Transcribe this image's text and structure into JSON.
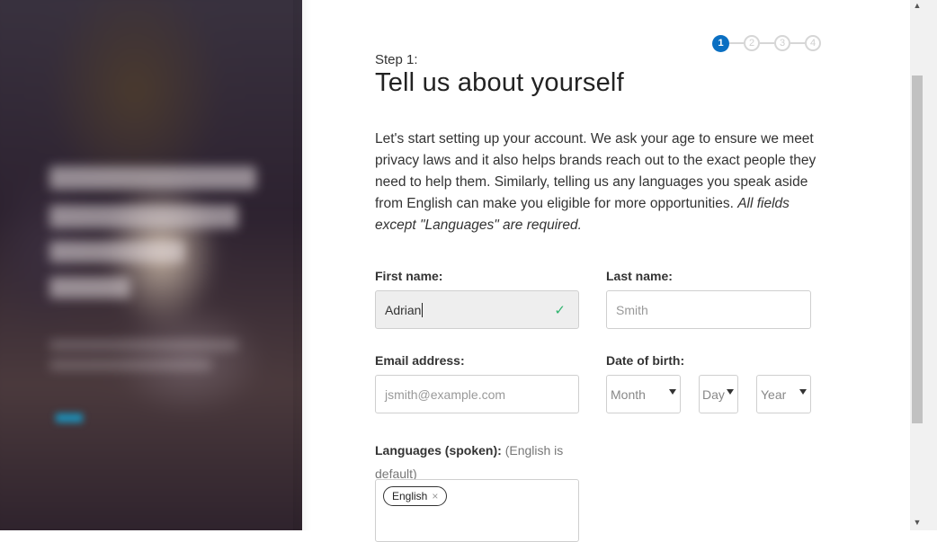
{
  "stepper": {
    "steps": [
      "1",
      "2",
      "3",
      "4"
    ],
    "active": 1
  },
  "header": {
    "kicker": "Step 1:",
    "title": "Tell us about yourself"
  },
  "intro": {
    "text": "Let's start setting up your account. We ask your age to ensure we meet privacy laws and it also helps brands reach out to the exact people they need to help them. Similarly, telling us any languages you speak aside from English can make you eligible for more opportunities. ",
    "note": "All fields except \"Languages\" are required."
  },
  "form": {
    "first_name": {
      "label": "First name:",
      "value": "Adrian",
      "valid_icon": "checkmark-icon"
    },
    "last_name": {
      "label": "Last name:",
      "placeholder": "Smith"
    },
    "email": {
      "label": "Email address:",
      "placeholder": "jsmith@example.com"
    },
    "dob": {
      "label": "Date of birth:",
      "month": "Month",
      "day": "Day",
      "year": "Year"
    },
    "languages": {
      "label": "Languages (spoken):",
      "hint": "(English is default)",
      "tags": [
        "English"
      ],
      "remove_glyph": "×"
    }
  },
  "scrollbar": {
    "up": "▲",
    "down": "▼"
  },
  "colors": {
    "accent": "#0a6fc2",
    "valid": "#2fb46e"
  }
}
